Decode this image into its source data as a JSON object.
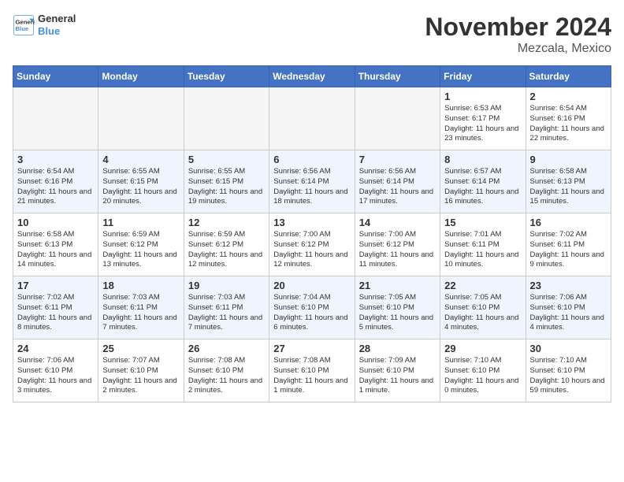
{
  "logo": {
    "line1": "General",
    "line2": "Blue"
  },
  "title": "November 2024",
  "subtitle": "Mezcala, Mexico",
  "days_of_week": [
    "Sunday",
    "Monday",
    "Tuesday",
    "Wednesday",
    "Thursday",
    "Friday",
    "Saturday"
  ],
  "weeks": [
    [
      {
        "day": "",
        "info": ""
      },
      {
        "day": "",
        "info": ""
      },
      {
        "day": "",
        "info": ""
      },
      {
        "day": "",
        "info": ""
      },
      {
        "day": "",
        "info": ""
      },
      {
        "day": "1",
        "info": "Sunrise: 6:53 AM\nSunset: 6:17 PM\nDaylight: 11 hours and 23 minutes."
      },
      {
        "day": "2",
        "info": "Sunrise: 6:54 AM\nSunset: 6:16 PM\nDaylight: 11 hours and 22 minutes."
      }
    ],
    [
      {
        "day": "3",
        "info": "Sunrise: 6:54 AM\nSunset: 6:16 PM\nDaylight: 11 hours and 21 minutes."
      },
      {
        "day": "4",
        "info": "Sunrise: 6:55 AM\nSunset: 6:15 PM\nDaylight: 11 hours and 20 minutes."
      },
      {
        "day": "5",
        "info": "Sunrise: 6:55 AM\nSunset: 6:15 PM\nDaylight: 11 hours and 19 minutes."
      },
      {
        "day": "6",
        "info": "Sunrise: 6:56 AM\nSunset: 6:14 PM\nDaylight: 11 hours and 18 minutes."
      },
      {
        "day": "7",
        "info": "Sunrise: 6:56 AM\nSunset: 6:14 PM\nDaylight: 11 hours and 17 minutes."
      },
      {
        "day": "8",
        "info": "Sunrise: 6:57 AM\nSunset: 6:14 PM\nDaylight: 11 hours and 16 minutes."
      },
      {
        "day": "9",
        "info": "Sunrise: 6:58 AM\nSunset: 6:13 PM\nDaylight: 11 hours and 15 minutes."
      }
    ],
    [
      {
        "day": "10",
        "info": "Sunrise: 6:58 AM\nSunset: 6:13 PM\nDaylight: 11 hours and 14 minutes."
      },
      {
        "day": "11",
        "info": "Sunrise: 6:59 AM\nSunset: 6:12 PM\nDaylight: 11 hours and 13 minutes."
      },
      {
        "day": "12",
        "info": "Sunrise: 6:59 AM\nSunset: 6:12 PM\nDaylight: 11 hours and 12 minutes."
      },
      {
        "day": "13",
        "info": "Sunrise: 7:00 AM\nSunset: 6:12 PM\nDaylight: 11 hours and 12 minutes."
      },
      {
        "day": "14",
        "info": "Sunrise: 7:00 AM\nSunset: 6:12 PM\nDaylight: 11 hours and 11 minutes."
      },
      {
        "day": "15",
        "info": "Sunrise: 7:01 AM\nSunset: 6:11 PM\nDaylight: 11 hours and 10 minutes."
      },
      {
        "day": "16",
        "info": "Sunrise: 7:02 AM\nSunset: 6:11 PM\nDaylight: 11 hours and 9 minutes."
      }
    ],
    [
      {
        "day": "17",
        "info": "Sunrise: 7:02 AM\nSunset: 6:11 PM\nDaylight: 11 hours and 8 minutes."
      },
      {
        "day": "18",
        "info": "Sunrise: 7:03 AM\nSunset: 6:11 PM\nDaylight: 11 hours and 7 minutes."
      },
      {
        "day": "19",
        "info": "Sunrise: 7:03 AM\nSunset: 6:11 PM\nDaylight: 11 hours and 7 minutes."
      },
      {
        "day": "20",
        "info": "Sunrise: 7:04 AM\nSunset: 6:10 PM\nDaylight: 11 hours and 6 minutes."
      },
      {
        "day": "21",
        "info": "Sunrise: 7:05 AM\nSunset: 6:10 PM\nDaylight: 11 hours and 5 minutes."
      },
      {
        "day": "22",
        "info": "Sunrise: 7:05 AM\nSunset: 6:10 PM\nDaylight: 11 hours and 4 minutes."
      },
      {
        "day": "23",
        "info": "Sunrise: 7:06 AM\nSunset: 6:10 PM\nDaylight: 11 hours and 4 minutes."
      }
    ],
    [
      {
        "day": "24",
        "info": "Sunrise: 7:06 AM\nSunset: 6:10 PM\nDaylight: 11 hours and 3 minutes."
      },
      {
        "day": "25",
        "info": "Sunrise: 7:07 AM\nSunset: 6:10 PM\nDaylight: 11 hours and 2 minutes."
      },
      {
        "day": "26",
        "info": "Sunrise: 7:08 AM\nSunset: 6:10 PM\nDaylight: 11 hours and 2 minutes."
      },
      {
        "day": "27",
        "info": "Sunrise: 7:08 AM\nSunset: 6:10 PM\nDaylight: 11 hours and 1 minute."
      },
      {
        "day": "28",
        "info": "Sunrise: 7:09 AM\nSunset: 6:10 PM\nDaylight: 11 hours and 1 minute."
      },
      {
        "day": "29",
        "info": "Sunrise: 7:10 AM\nSunset: 6:10 PM\nDaylight: 11 hours and 0 minutes."
      },
      {
        "day": "30",
        "info": "Sunrise: 7:10 AM\nSunset: 6:10 PM\nDaylight: 10 hours and 59 minutes."
      }
    ]
  ]
}
